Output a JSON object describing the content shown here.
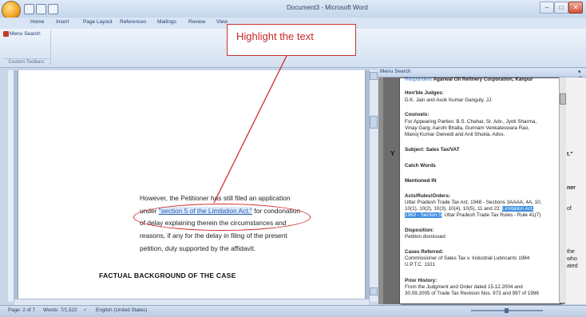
{
  "window": {
    "title": "Document3 - Microsoft Word",
    "controls": {
      "minimize": "–",
      "maximize": "□",
      "close": "✕"
    }
  },
  "ribbon": {
    "tabs": [
      "Home",
      "Insert",
      "Page Layout",
      "References",
      "Mailings",
      "Review",
      "View"
    ],
    "menu_search_button": "Menu Search",
    "group_label": "Custom Toolbars"
  },
  "callout": {
    "text": "Highlight the text"
  },
  "document": {
    "paragraph": {
      "line1": "However, the Petitioner has still filed an application",
      "line2_pre": "under ",
      "line2_sel": "\"section 5 of the Limitation Act.\"",
      "line2_post": " for condonation",
      "line3": "of delay explaining therein the circumstances and",
      "line4": "reasons, if any for the delay in filing of the present",
      "line5": "petition, duly supported by the affidavit."
    },
    "heading": "FACTUAL BACKGROUND OF THE CASE"
  },
  "pane": {
    "title": "Menu Search",
    "close": "▾ ✕",
    "popup": {
      "party_link": "Respondent",
      "party_text": " Agarwal Oil Refinery Corporation, Kanpur",
      "judges_label": "Hon'ble Judges:",
      "judges": "D.K. Jain and Asok Kumar Ganguly, JJ.",
      "counsels_label": "Counsels:",
      "counsels_1": "For Appearing Parties: B.S. Chahar, Sr. Adv., Jyoti Sharma,",
      "counsels_2": "Vinay Garg, Aarohi Bhalla, Gunnam Venkateswara Rao,",
      "counsels_3": "Manoj Kumar Dwivedi and Anil Shukla, Advs.",
      "subject": "Subject: Sales Tax/VAT",
      "catch_words": "Catch Words",
      "mentioned_in": "Mentioned IN",
      "acts_label": "Acts/Rules/Orders:",
      "acts_1": "Uttar Pradesh Trade Tax Act, 1948 - Sections 3AAAA, 4A, 10,",
      "acts_2_pre": "10(1), 10(2), 10(3), 10(4), 10(5), 11 and 22; ",
      "acts_2_sel": "Limitation Act,",
      "acts_3_sel": "1963 - Section 5",
      "acts_3_post": "; Uttar Pradesh Trade Tax Rules - Rule 41(7)",
      "disposition_label": "Disposition:",
      "disposition": "Petition dismissed",
      "cases_label": "Cases Referred:",
      "cases_1": "Commissioner of Sales Tax v. Industrial Lubricants 1984",
      "cases_2": "U.P.T.C. 1101",
      "prior_label": "Prior History:",
      "prior_1": "From the Judgment and Order dated 15.12.2004 and",
      "prior_2": "30.09.2005 of Trade Tax Revision Nos. 973 and 997 of 1996"
    },
    "side_fragments": [
      "t.\"",
      "ner",
      "of",
      "the",
      "who",
      "ated"
    ],
    "left_fragment": "Y"
  },
  "statusbar": {
    "page": "Page: 2 of 7",
    "words": "Words: 7/1,522",
    "language": "English (United States)"
  },
  "colors": {
    "accent": "#2a5fb0",
    "callout": "#c62828",
    "selection": "#3d8ee0"
  }
}
